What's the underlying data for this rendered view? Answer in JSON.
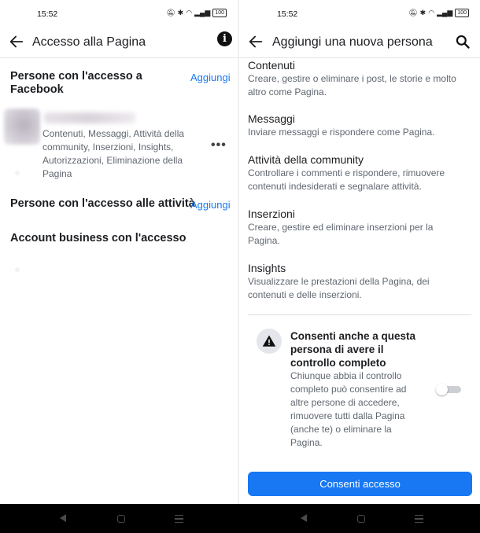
{
  "status_bar": {
    "time": "15:52",
    "battery": "100"
  },
  "left": {
    "title": "Accesso alla Pagina",
    "section_facebook": "Persone con l'accesso a Facebook",
    "add_label_facebook": "Aggiungi",
    "member_permissions": "Contenuti, Messaggi, Attività della community, Inserzioni, Insights, Autorizzazioni, Eliminazione della Pagina",
    "section_tasks": "Persone con l'accesso alle attività",
    "add_label_tasks": "Aggiungi",
    "section_business": "Account business con l'accesso"
  },
  "right": {
    "title": "Aggiungi una nuova persona",
    "permissions": [
      {
        "name": "Contenuti",
        "desc": "Creare, gestire o eliminare i post, le storie e molto altro come Pagina."
      },
      {
        "name": "Messaggi",
        "desc": "Inviare messaggi e rispondere come Pagina."
      },
      {
        "name": "Attività della community",
        "desc": "Controllare i commenti e rispondere, rimuovere contenuti indesiderati e segnalare attività."
      },
      {
        "name": "Inserzioni",
        "desc": "Creare, gestire ed eliminare inserzioni per la Pagina."
      },
      {
        "name": "Insights",
        "desc": "Visualizzare le prestazioni della Pagina, dei contenuti e delle inserzioni."
      }
    ],
    "full_control_title": "Consenti anche a questa persona di avere il controllo completo",
    "full_control_desc": "Chiunque abbia il controllo completo può consentire ad altre persone di accedere, rimuovere tutti dalla Pagina (anche te) o eliminare la Pagina.",
    "full_control_enabled": false,
    "submit_label": "Consenti accesso"
  },
  "colors": {
    "accent": "#1877f2",
    "text": "#1c1e21",
    "secondary": "#606770",
    "navbar": "#000000"
  },
  "icons": [
    "back-arrow-icon",
    "info-icon",
    "search-icon",
    "more-icon",
    "warning-icon",
    "nav-back-icon",
    "nav-home-icon",
    "nav-recents-icon"
  ]
}
